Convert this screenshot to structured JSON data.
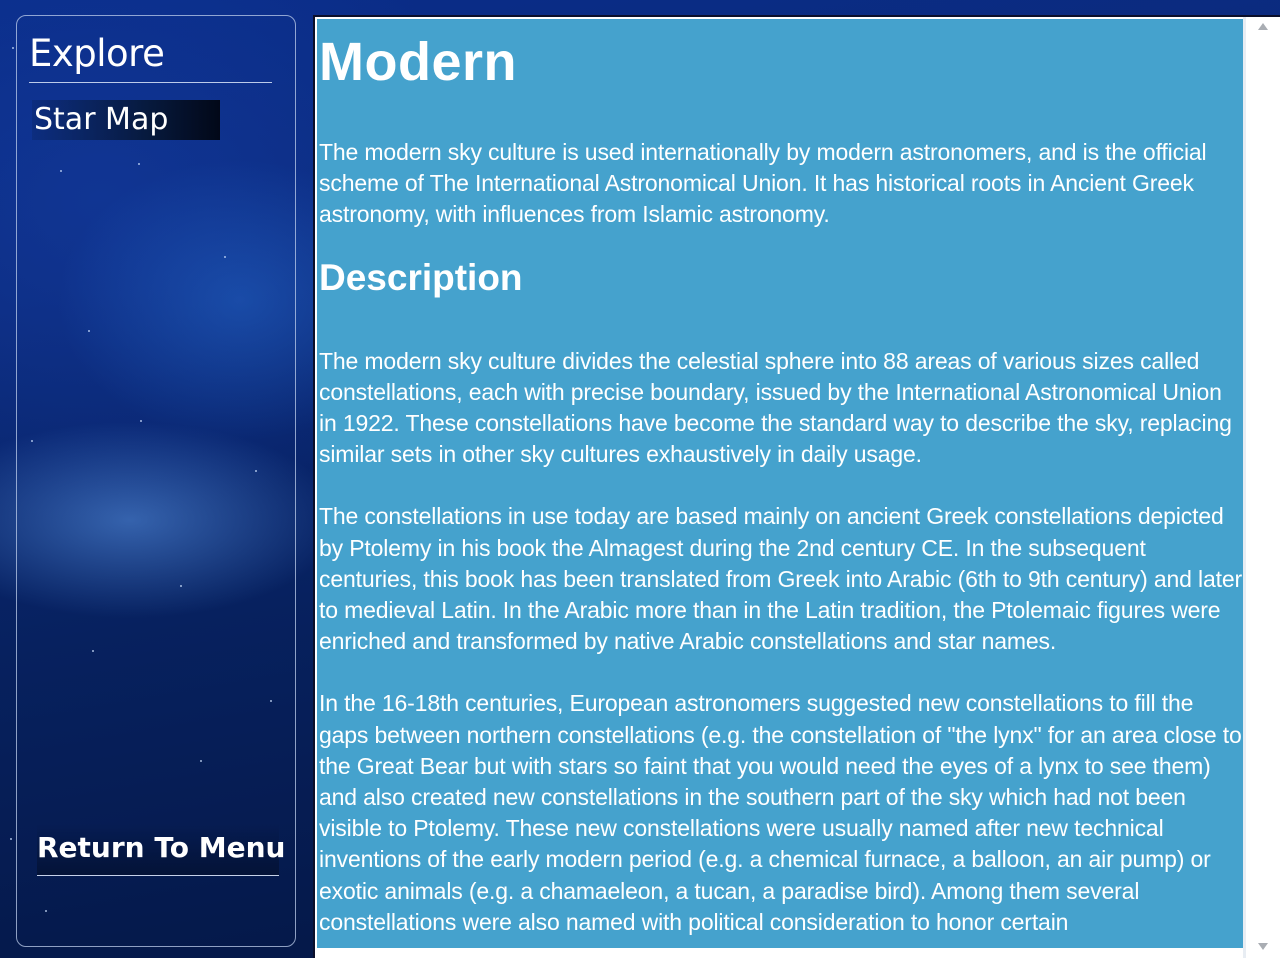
{
  "sidebar": {
    "title": "Explore",
    "items": [
      {
        "label": "Star Map"
      }
    ],
    "return_label": "Return To Menu"
  },
  "content": {
    "title": "Modern",
    "intro": "The modern sky culture is used internationally by modern astronomers, and is the official scheme of The International Astronomical Union. It has historical roots in Ancient Greek astronomy, with influences from Islamic astronomy.",
    "description_heading": "Description",
    "paragraphs": [
      "The modern sky culture divides the celestial sphere into 88 areas of various sizes called constellations, each with precise boundary, issued by the International Astronomical Union in 1922. These constellations have become the standard way to describe the sky, replacing similar sets in other sky cultures exhaustively in daily usage.",
      "The constellations in use today are based mainly on ancient Greek constellations depicted by Ptolemy in his book the Almagest during the 2nd century CE. In the subsequent centuries, this book has been translated from Greek into Arabic (6th to 9th century) and later to medieval Latin. In the Arabic more than in the Latin tradition, the Ptolemaic figures were enriched and transformed by native Arabic constellations and star names.",
      "In the 16-18th centuries, European astronomers suggested new constellations to fill the gaps between northern constellations (e.g. the constellation of \"the lynx\" for an area close to the Great Bear but with stars so faint that you would need the eyes of a lynx to see them) and also created new constellations in the southern part of the sky which had not been visible to Ptolemy. These new constellations were usually named after new technical inventions of the early modern period (e.g. a chemical furnace, a balloon, an air pump) or exotic animals (e.g. a chamaeleon, a tucan, a paradise bird). Among them several constellations were also named with political consideration to honor certain"
    ]
  },
  "icons": {
    "scroll_up": "chevron-up-icon",
    "scroll_down": "chevron-down-icon"
  },
  "colors": {
    "content_background": "#45a2cd",
    "text": "#ffffff",
    "sidebar_border": "#bccbe9"
  }
}
